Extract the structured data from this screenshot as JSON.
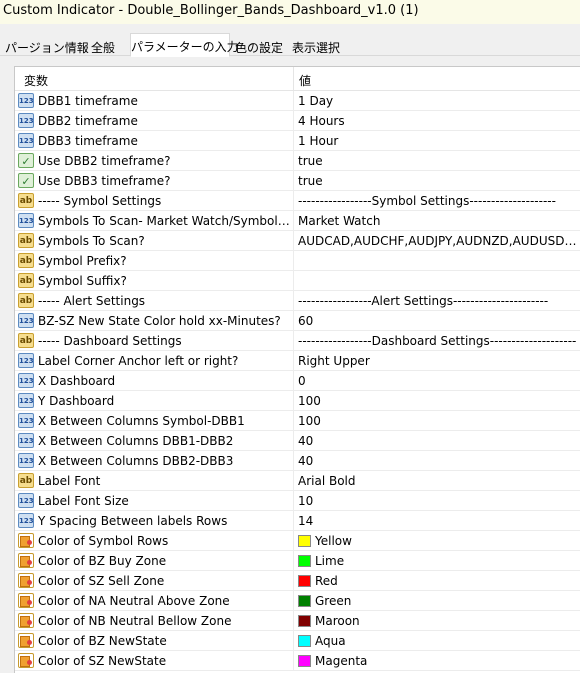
{
  "window": {
    "title": "Custom Indicator - Double_Bollinger_Bands_Dashboard_v1.0 (1)"
  },
  "tabs": [
    {
      "label": "パージョン情報",
      "active": false
    },
    {
      "label": "全般",
      "active": false
    },
    {
      "label": "パラメーターの入力",
      "active": true
    },
    {
      "label": "色の設定",
      "active": false
    },
    {
      "label": "表示選択",
      "active": false
    }
  ],
  "table": {
    "headers": {
      "variable": "変数",
      "value": "値"
    },
    "rows": [
      {
        "icon": "number-icon",
        "name": "DBB1 timeframe",
        "value": "1 Day"
      },
      {
        "icon": "number-icon",
        "name": "DBB2 timeframe",
        "value": "4 Hours"
      },
      {
        "icon": "number-icon",
        "name": "DBB3 timeframe",
        "value": "1 Hour"
      },
      {
        "icon": "bool-icon",
        "name": "Use DBB2 timeframe?",
        "value": "true"
      },
      {
        "icon": "bool-icon",
        "name": "Use DBB3 timeframe?",
        "value": "true"
      },
      {
        "icon": "string-icon",
        "name": "----- Symbol Settings",
        "value": "-----------------Symbol Settings--------------------"
      },
      {
        "icon": "number-icon",
        "name": "Symbols To Scan- Market Watch/Symbol List ...",
        "value": "Market Watch"
      },
      {
        "icon": "string-icon",
        "name": "Symbols To Scan?",
        "value": "AUDCAD,AUDCHF,AUDJPY,AUDNZD,AUDUSD,CA..."
      },
      {
        "icon": "string-icon",
        "name": "Symbol Prefix?",
        "value": ""
      },
      {
        "icon": "string-icon",
        "name": "Symbol Suffix?",
        "value": ""
      },
      {
        "icon": "string-icon",
        "name": "----- Alert Settings",
        "value": "-----------------Alert Settings----------------------"
      },
      {
        "icon": "number-icon",
        "name": "BZ-SZ New State Color hold xx-Minutes?",
        "value": "60"
      },
      {
        "icon": "string-icon",
        "name": "----- Dashboard Settings",
        "value": "-----------------Dashboard Settings--------------------"
      },
      {
        "icon": "number-icon",
        "name": "Label Corner Anchor left or right?",
        "value": "Right Upper"
      },
      {
        "icon": "number-icon",
        "name": "X Dashboard",
        "value": "0"
      },
      {
        "icon": "number-icon",
        "name": "Y Dashboard",
        "value": "100"
      },
      {
        "icon": "number-icon",
        "name": "X  Between Columns Symbol-DBB1",
        "value": "100"
      },
      {
        "icon": "number-icon",
        "name": "X  Between Columns DBB1-DBB2",
        "value": "40"
      },
      {
        "icon": "number-icon",
        "name": "X  Between Columns DBB2-DBB3",
        "value": "40"
      },
      {
        "icon": "string-icon",
        "name": "Label Font",
        "value": "Arial Bold"
      },
      {
        "icon": "number-icon",
        "name": "Label Font Size",
        "value": "10"
      },
      {
        "icon": "number-icon",
        "name": "Y Spacing Between labels Rows",
        "value": "14"
      },
      {
        "icon": "color-icon",
        "name": "Color of Symbol Rows",
        "value": "Yellow",
        "swatch": "#ffff00"
      },
      {
        "icon": "color-icon",
        "name": "Color of BZ Buy Zone",
        "value": "Lime",
        "swatch": "#00ff00"
      },
      {
        "icon": "color-icon",
        "name": "Color of SZ Sell Zone",
        "value": "Red",
        "swatch": "#ff0000"
      },
      {
        "icon": "color-icon",
        "name": "Color of NA Neutral Above Zone",
        "value": "Green",
        "swatch": "#008000"
      },
      {
        "icon": "color-icon",
        "name": "Color of NB Neutral Bellow Zone",
        "value": "Maroon",
        "swatch": "#800000"
      },
      {
        "icon": "color-icon",
        "name": "Color of BZ NewState",
        "value": "Aqua",
        "swatch": "#00ffff"
      },
      {
        "icon": "color-icon",
        "name": "Color of SZ NewState",
        "value": "Magenta",
        "swatch": "#ff00ff"
      }
    ]
  },
  "icon_glyphs": {
    "number-icon": "123",
    "string-icon": "ab",
    "bool-icon": "✓",
    "color-icon": ""
  }
}
